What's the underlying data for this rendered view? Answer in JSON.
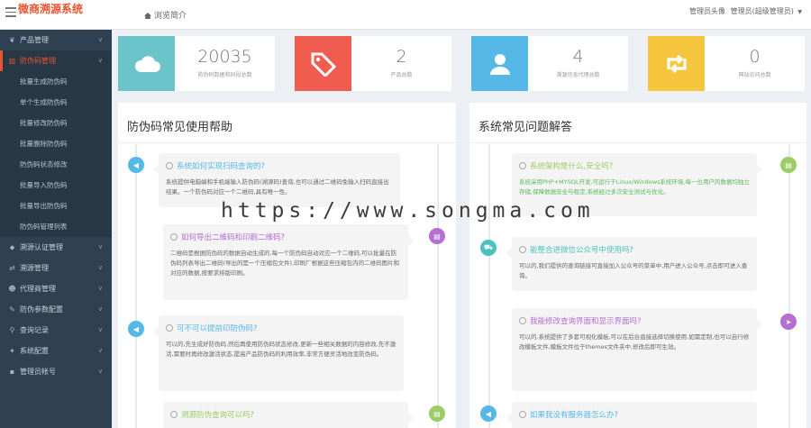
{
  "header": {
    "brand": "微商溯源系统",
    "breadcrumb": "浏览简介",
    "avatar_alt": "管理员头像",
    "user_label": "管理员(超级管理员)"
  },
  "sidebar": {
    "items": [
      {
        "label": "产品管理",
        "icon": "leaf-icon"
      },
      {
        "label": "防伪码管理",
        "icon": "barcode-icon",
        "active": true
      },
      {
        "label": "溯源认证管理",
        "icon": "tag-icon"
      },
      {
        "label": "溯源管理",
        "icon": "exchange-icon"
      },
      {
        "label": "代理商管理",
        "icon": "users-icon"
      },
      {
        "label": "防伪参数配置",
        "icon": "wrench-icon"
      },
      {
        "label": "查询记录",
        "icon": "search-icon"
      },
      {
        "label": "系统配置",
        "icon": "settings-icon"
      },
      {
        "label": "管理员帐号",
        "icon": "lock-icon"
      }
    ],
    "sub_items": [
      "批量生成防伪码",
      "单个生成防伪码",
      "批量修改防伪码",
      "批量删除防伪码",
      "防伪码状态修改",
      "批量导入防伪码",
      "批量导出防伪码",
      "防伪码管理列表"
    ]
  },
  "stats": [
    {
      "value": "20035",
      "label": "防伪码数据和码段总数",
      "color": "#6bc4c9",
      "icon": "cloud-icon"
    },
    {
      "value": "2",
      "label": "产品总数",
      "color": "#f05d50",
      "icon": "tag-icon"
    },
    {
      "value": "4",
      "label": "溯源信息代理总数",
      "color": "#56b8e6",
      "icon": "user-icon"
    },
    {
      "value": "0",
      "label": "网站访问总数",
      "color": "#f6c63e",
      "icon": "retweet-icon"
    }
  ],
  "left_panel": {
    "title": "防伪码常见使用帮助",
    "entries": [
      {
        "q": "系统如何实现扫码查询的?",
        "a": "系统提供电脑端和手机端输入防伪码(溯源码)查询,也可以通过二维码免输入扫码直接出结果。一个防伪码对应一个二维码,具有唯一性。"
      },
      {
        "q": "如何导出二维码和印刷二维码?",
        "a": "二维码是根据防伪码的数据自动生成的,每一个防伪码自动对应一个二维码,可以批量在防伪码列表导出二维码(导出的是一个压缩包文件),印刷厂根据这些压缩包内的二维码图片和对应的数据,按要求排版印刷。"
      },
      {
        "q": "可不可以提前印防伪码?",
        "a": "可以的,先生成好防伪码,然后再使用防伪码状态修改,更新一些相关数据的内容修改,先不激活,需要时再修改激活状态,提高产品防伪码的利用效率,非常方便灵活地改变防伪码。"
      },
      {
        "q": "溯源防伪查询可以吗?",
        "a": ""
      }
    ]
  },
  "right_panel": {
    "title": "系统常见问题解答",
    "entries": [
      {
        "q": "系统架构是什么,安全吗?",
        "a": "系统采用PHP+MYSQL开发,可运行于Linux/Windows系统环境,每一位用户的数据均独立存储,保障数据安全与稳定,系统经过多次安全测试与优化。"
      },
      {
        "q": "能整合进微信公众号中使用吗?",
        "a": "可以的,我们提供的查询链接可直接加入公众号的菜单中,用户进入公众号,点击即可进入查询。"
      },
      {
        "q": "我能修改查询界面和显示界面吗?",
        "a": "可以的,系统提供了多套可视化模板,可以在后台直接选择切换使用,如需定制,也可以自行修改模板文件,模板文件位于themes文件夹中,修改后即可生效。"
      },
      {
        "q": "如果我没有服务器怎么办?",
        "a": ""
      }
    ]
  },
  "watermark": "https://www.songma.com"
}
